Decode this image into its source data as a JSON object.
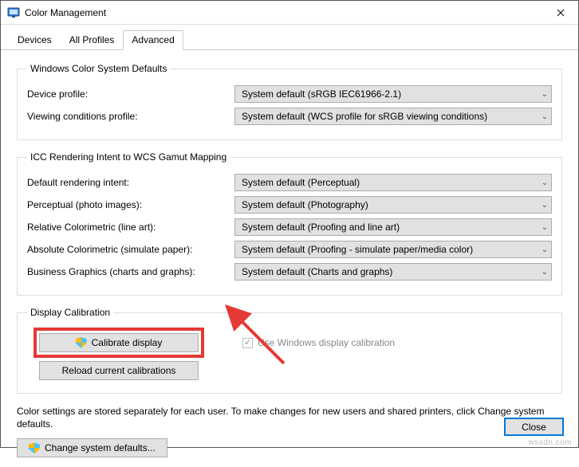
{
  "window": {
    "title": "Color Management"
  },
  "tabs": {
    "devices": "Devices",
    "all_profiles": "All Profiles",
    "advanced": "Advanced"
  },
  "group1": {
    "legend": "Windows Color System Defaults",
    "device_profile_label": "Device profile:",
    "device_profile_value": "System default (sRGB IEC61966-2.1)",
    "viewing_label": "Viewing conditions profile:",
    "viewing_value": "System default (WCS profile for sRGB viewing conditions)"
  },
  "group2": {
    "legend": "ICC Rendering Intent to WCS Gamut Mapping",
    "default_intent_label": "Default rendering intent:",
    "default_intent_value": "System default (Perceptual)",
    "perceptual_label": "Perceptual (photo images):",
    "perceptual_value": "System default (Photography)",
    "relative_label": "Relative Colorimetric (line art):",
    "relative_value": "System default (Proofing and line art)",
    "absolute_label": "Absolute Colorimetric (simulate paper):",
    "absolute_value": "System default (Proofing - simulate paper/media color)",
    "business_label": "Business Graphics (charts and graphs):",
    "business_value": "System default (Charts and graphs)"
  },
  "group3": {
    "legend": "Display Calibration",
    "calibrate_btn": "Calibrate display",
    "use_windows_cal": "Use Windows display calibration",
    "reload_btn": "Reload current calibrations"
  },
  "footer": {
    "note": "Color settings are stored separately for each user. To make changes for new users and shared printers, click Change system defaults.",
    "change_defaults_btn": "Change system defaults..."
  },
  "close_btn": "Close",
  "watermark": "wsxdn.com"
}
